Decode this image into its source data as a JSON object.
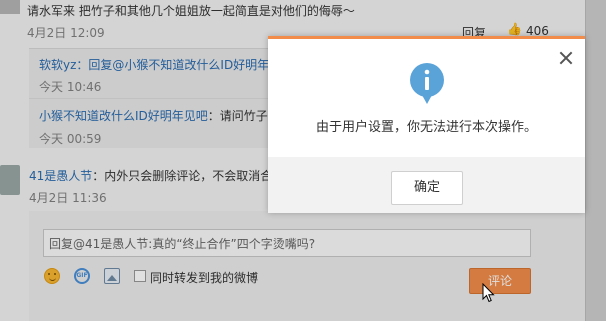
{
  "feed": {
    "top_comment": {
      "text": "请水军来 把竹子和其他几个姐姐放一起简直是对他们的侮辱～",
      "time": "4月2日 12:09",
      "reply_label": "回复",
      "like_count": "406"
    },
    "replies": [
      {
        "user": "软软yz",
        "text": "：回复@小猴不知道改什么ID好明年",
        "time": "今天 10:46"
      },
      {
        "user": "小猴不知道改什么ID好明年见吧",
        "text": "：请问竹子",
        "time": "今天 00:59"
      }
    ],
    "comment2": {
      "user": "41是愚人节",
      "text": "：内外只会删除评论，不会取消合",
      "time": "4月2日 11:36"
    }
  },
  "composer": {
    "input_value": "回复@41是愚人节:真的“终止合作”四个字烫嘴吗?",
    "repost_label": "同时转发到我的微博",
    "submit_label": "评论",
    "icons": [
      "emoji-icon",
      "gif-icon",
      "image-icon"
    ]
  },
  "dialog": {
    "message": "由于用户设置，你无法进行本次操作。",
    "confirm_label": "确定",
    "icon": "info-icon",
    "accent_color": "#f18c4a",
    "icon_color": "#5aa3d9"
  }
}
